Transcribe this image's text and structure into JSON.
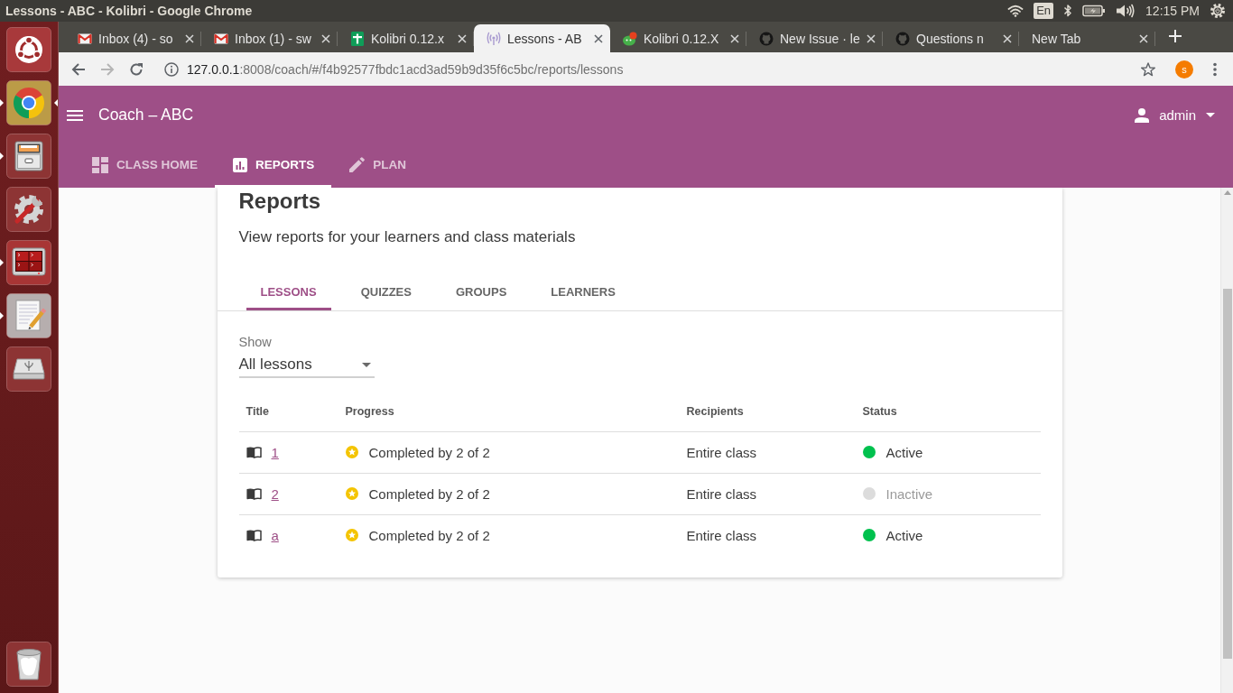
{
  "panel": {
    "title": "Lessons - ABC - Kolibri - Google Chrome",
    "keyboard": "En",
    "clock": "12:15 PM"
  },
  "launcher": {
    "items": [
      {
        "kind": "logo",
        "running": false,
        "focused": false
      },
      {
        "kind": "browser",
        "running": true,
        "focused": true
      },
      {
        "kind": "files",
        "running": true,
        "focused": false
      },
      {
        "kind": "settings",
        "running": false,
        "focused": false
      },
      {
        "kind": "terminal",
        "running": true,
        "focused": false
      },
      {
        "kind": "editor",
        "running": true,
        "focused": false
      },
      {
        "kind": "drive",
        "running": false,
        "focused": false
      },
      {
        "kind": "trash",
        "running": false,
        "focused": false
      }
    ]
  },
  "browser": {
    "tabs": [
      {
        "title": "Inbox (4) - so",
        "kind": "mail",
        "selected": false
      },
      {
        "title": "Inbox (1) - sw",
        "kind": "mail",
        "selected": false
      },
      {
        "title": "Kolibri 0.12.x",
        "kind": "sheet",
        "selected": false
      },
      {
        "title": "Lessons - AB",
        "kind": "signal",
        "selected": true
      },
      {
        "title": "Kolibri 0.12.X",
        "kind": "kolibri",
        "selected": false
      },
      {
        "title": "New Issue · le",
        "kind": "github",
        "selected": false
      },
      {
        "title": "Questions n",
        "kind": "github",
        "selected": false
      },
      {
        "title": "New Tab",
        "kind": "blank",
        "selected": false
      }
    ],
    "buttons": [
      {
        "kind": "back",
        "disabled": false
      },
      {
        "kind": "forward",
        "disabled": true
      },
      {
        "kind": "reload",
        "disabled": false
      }
    ],
    "address": {
      "host": "127.0.0.1",
      "path": ":8008/coach/#/f4b92577fbdc1acd3ad59b9d35f6c5bc/reports/lessons"
    },
    "profile": "s"
  },
  "app": {
    "title": "Coach – ABC",
    "user": "admin",
    "nav": [
      {
        "label": "CLASS HOME",
        "kind": "home",
        "selected": false
      },
      {
        "label": "REPORTS",
        "kind": "reports",
        "selected": true
      },
      {
        "label": "PLAN",
        "kind": "plan",
        "selected": false
      }
    ]
  },
  "page": {
    "heading": "Reports",
    "subtitle": "View reports for your learners and class materials",
    "tabs": [
      {
        "label": "LESSONS",
        "selected": true
      },
      {
        "label": "QUIZZES",
        "selected": false
      },
      {
        "label": "GROUPS",
        "selected": false
      },
      {
        "label": "LEARNERS",
        "selected": false
      }
    ],
    "filter": {
      "label": "Show",
      "value": "All lessons"
    },
    "table": {
      "columns": [
        "Title",
        "Progress",
        "Recipients",
        "Status"
      ],
      "rows": [
        {
          "title": "1",
          "progress": "Completed by 2 of 2",
          "recipients": "Entire class",
          "status": "Active",
          "active": true,
          "color": "#00c14e"
        },
        {
          "title": "2",
          "progress": "Completed by 2 of 2",
          "recipients": "Entire class",
          "status": "Inactive",
          "active": false,
          "color": "#dcdcdc"
        },
        {
          "title": "a",
          "progress": "Completed by 2 of 2",
          "recipients": "Entire class",
          "status": "Active",
          "active": true,
          "color": "#00c14e"
        }
      ]
    }
  }
}
